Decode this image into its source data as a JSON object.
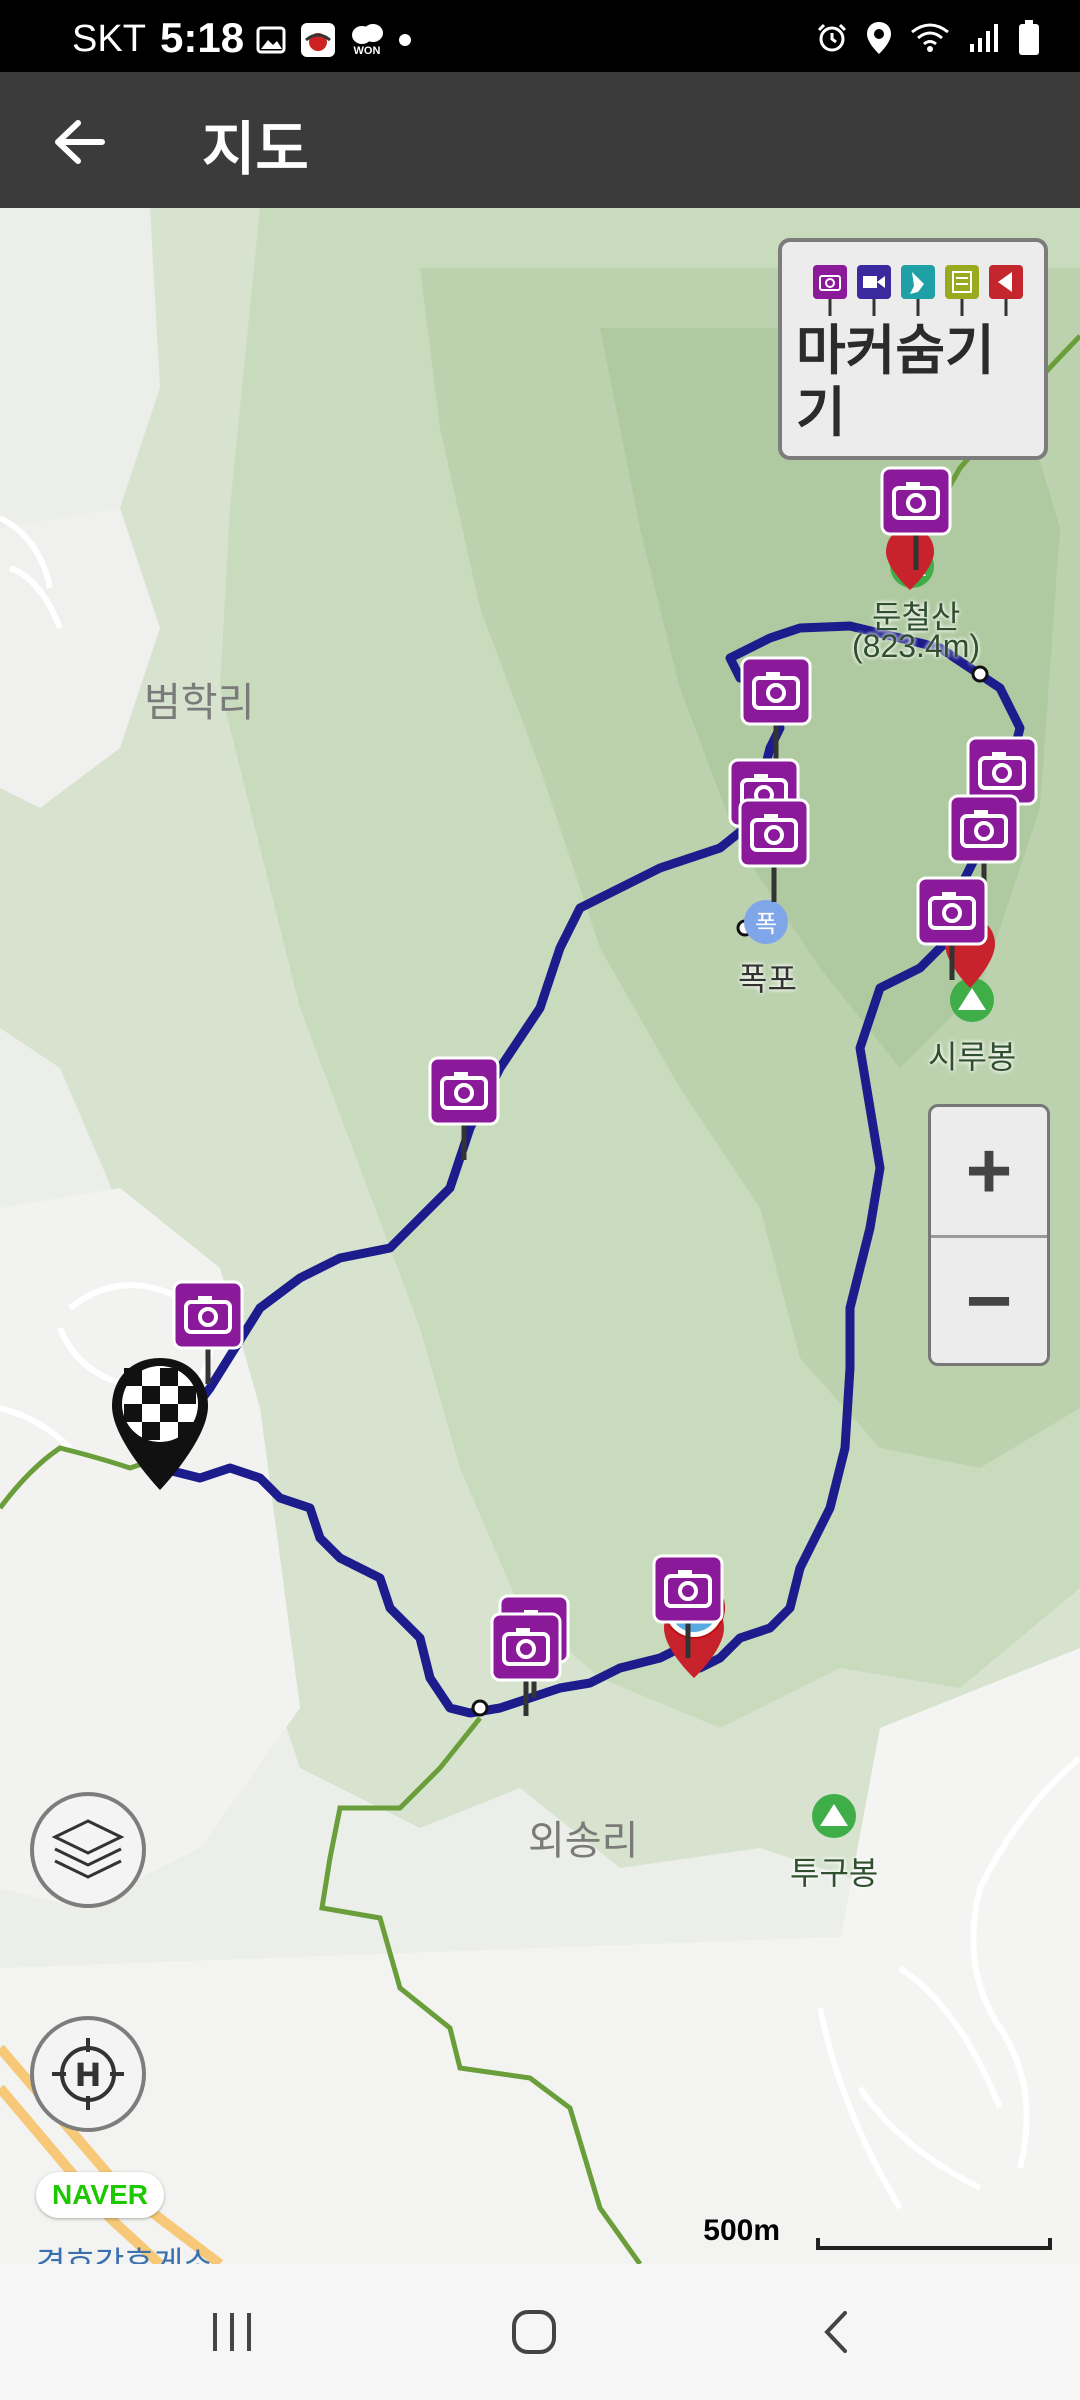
{
  "status_bar": {
    "carrier": "SKT",
    "time": "5:18",
    "won_label": "WON",
    "icons": [
      "gallery-icon",
      "app-notification-icon",
      "won-icon",
      "dot-icon",
      "alarm-icon",
      "location-icon",
      "wifi-icon",
      "signal-icon",
      "battery-icon"
    ]
  },
  "app_bar": {
    "title": "지도",
    "back_icon": "arrow-left-icon"
  },
  "map": {
    "places": {
      "beomhak": "범학리",
      "oesong": "외송리",
      "bottom_partial": "경호강휴게소"
    },
    "peaks": {
      "duncheol_name": "둔철산",
      "duncheol_alt": "(823.4m)",
      "siru": "시루봉",
      "tugu": "투구봉"
    },
    "waterfall": "폭포",
    "marker_panel": {
      "label": "마커숨기기",
      "icons": [
        "camera-icon",
        "video-icon",
        "pin-icon",
        "note-icon",
        "flag-icon"
      ],
      "colors": [
        "#8b1a9b",
        "#3a2a9e",
        "#1f9fa6",
        "#9aaa1e",
        "#c4262e"
      ]
    },
    "zoom": {
      "in": "+",
      "out": "−"
    },
    "layers_icon": "layers-icon",
    "home_icon": "home-location-icon",
    "naver": "NAVER",
    "scale": "500m",
    "route_color": "#1c1c8c",
    "trail_color": "#6a9e3a",
    "camera_marker_color": "#8b1a9b"
  },
  "nav_bar": {
    "icons": [
      "recent-apps-icon",
      "home-icon",
      "back-icon"
    ]
  }
}
